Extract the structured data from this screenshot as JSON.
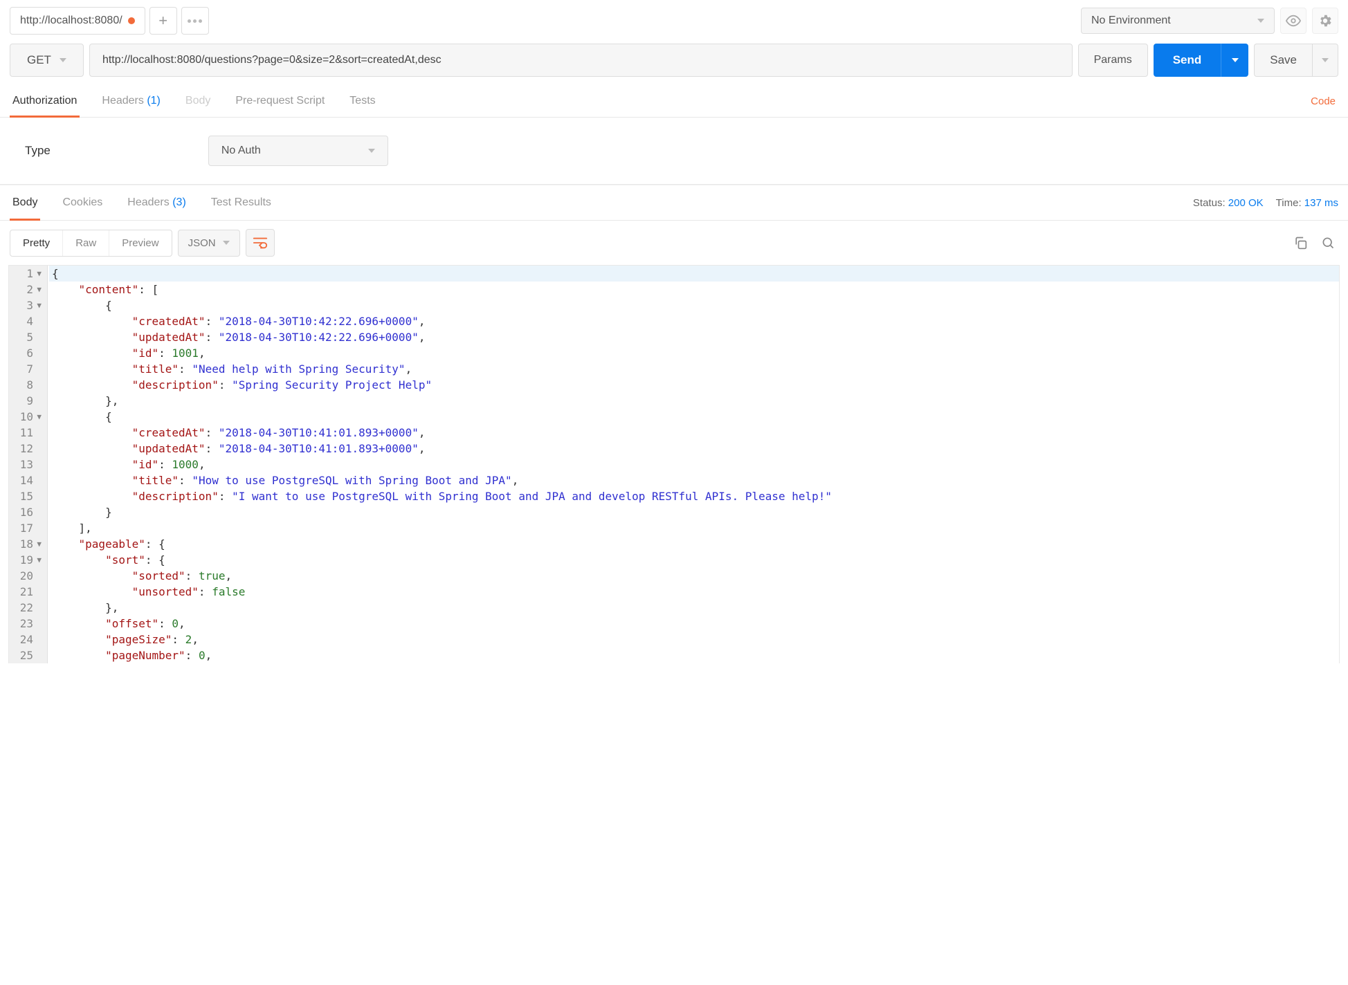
{
  "tab": {
    "label": "http://localhost:8080/"
  },
  "env": {
    "selected": "No Environment"
  },
  "request": {
    "method": "GET",
    "url": "http://localhost:8080/questions?page=0&size=2&sort=createdAt,desc",
    "params_label": "Params",
    "send_label": "Send",
    "save_label": "Save"
  },
  "req_tabs": {
    "authorization": "Authorization",
    "headers": "Headers",
    "headers_count": "(1)",
    "body": "Body",
    "prerequest": "Pre-request Script",
    "tests": "Tests",
    "code_link": "Code"
  },
  "auth": {
    "type_label": "Type",
    "selected": "No Auth"
  },
  "resp_tabs": {
    "body": "Body",
    "cookies": "Cookies",
    "headers": "Headers",
    "headers_count": "(3)",
    "testresults": "Test Results"
  },
  "resp_meta": {
    "status_label": "Status:",
    "status_value": "200 OK",
    "time_label": "Time:",
    "time_value": "137 ms"
  },
  "body_toolbar": {
    "pretty": "Pretty",
    "raw": "Raw",
    "preview": "Preview",
    "format": "JSON"
  },
  "lines": [
    {
      "fold": true,
      "txt": "{"
    },
    {
      "fold": true,
      "txt": "    \"content\": ["
    },
    {
      "fold": true,
      "txt": "        {"
    },
    {
      "txt": "            \"createdAt\": \"2018-04-30T10:42:22.696+0000\","
    },
    {
      "txt": "            \"updatedAt\": \"2018-04-30T10:42:22.696+0000\","
    },
    {
      "txt": "            \"id\": 1001,"
    },
    {
      "txt": "            \"title\": \"Need help with Spring Security\","
    },
    {
      "txt": "            \"description\": \"Spring Security Project Help\""
    },
    {
      "txt": "        },"
    },
    {
      "fold": true,
      "txt": "        {"
    },
    {
      "txt": "            \"createdAt\": \"2018-04-30T10:41:01.893+0000\","
    },
    {
      "txt": "            \"updatedAt\": \"2018-04-30T10:41:01.893+0000\","
    },
    {
      "txt": "            \"id\": 1000,"
    },
    {
      "txt": "            \"title\": \"How to use PostgreSQL with Spring Boot and JPA\","
    },
    {
      "txt": "            \"description\": \"I want to use PostgreSQL with Spring Boot and JPA and develop RESTful APIs. Please help!\""
    },
    {
      "txt": "        }"
    },
    {
      "txt": "    ],"
    },
    {
      "fold": true,
      "txt": "    \"pageable\": {"
    },
    {
      "fold": true,
      "txt": "        \"sort\": {"
    },
    {
      "txt": "            \"sorted\": true,"
    },
    {
      "txt": "            \"unsorted\": false"
    },
    {
      "txt": "        },"
    },
    {
      "txt": "        \"offset\": 0,"
    },
    {
      "txt": "        \"pageSize\": 2,"
    },
    {
      "txt": "        \"pageNumber\": 0,"
    }
  ]
}
